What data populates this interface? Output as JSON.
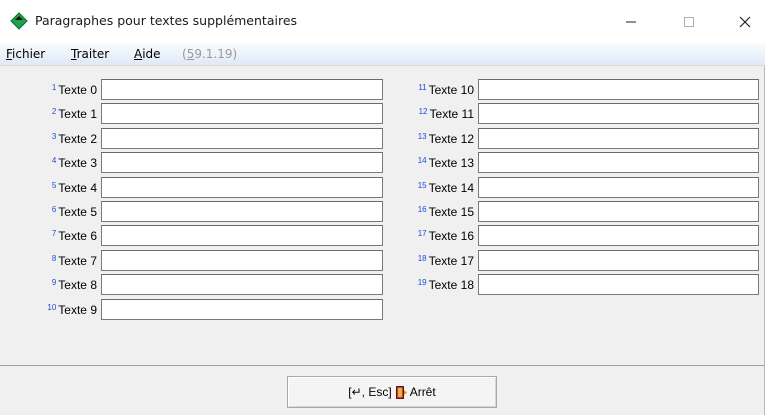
{
  "window": {
    "title": "Paragraphes pour textes supplémentaires",
    "icon": "green-diamond-app-icon",
    "controls": {
      "minimize": "–",
      "maximize": "□",
      "close": "✕"
    }
  },
  "menu": {
    "items": [
      {
        "first": "F",
        "rest": "ichier"
      },
      {
        "first": "T",
        "rest": "raiter"
      },
      {
        "first": "A",
        "rest": "ide"
      }
    ],
    "version_first": "5",
    "version_rest": "9.1.19",
    "version_prefix": "(",
    "version_suffix": ")"
  },
  "fields_left": [
    {
      "num": "1",
      "label": "Texte 0",
      "value": ""
    },
    {
      "num": "2",
      "label": "Texte 1",
      "value": ""
    },
    {
      "num": "3",
      "label": "Texte 2",
      "value": ""
    },
    {
      "num": "4",
      "label": "Texte 3",
      "value": ""
    },
    {
      "num": "5",
      "label": "Texte 4",
      "value": ""
    },
    {
      "num": "6",
      "label": "Texte 5",
      "value": ""
    },
    {
      "num": "7",
      "label": "Texte 6",
      "value": ""
    },
    {
      "num": "8",
      "label": "Texte 7",
      "value": ""
    },
    {
      "num": "9",
      "label": "Texte 8",
      "value": ""
    },
    {
      "num": "10",
      "label": "Texte 9",
      "value": ""
    }
  ],
  "fields_right": [
    {
      "num": "11",
      "label": "Texte 10",
      "value": ""
    },
    {
      "num": "12",
      "label": "Texte 11",
      "value": ""
    },
    {
      "num": "13",
      "label": "Texte 12",
      "value": ""
    },
    {
      "num": "14",
      "label": "Texte 13",
      "value": ""
    },
    {
      "num": "15",
      "label": "Texte 14",
      "value": ""
    },
    {
      "num": "16",
      "label": "Texte 15",
      "value": ""
    },
    {
      "num": "17",
      "label": "Texte 16",
      "value": ""
    },
    {
      "num": "18",
      "label": "Texte 17",
      "value": ""
    },
    {
      "num": "19",
      "label": "Texte 18",
      "value": ""
    }
  ],
  "footer": {
    "stop_prefix": "[↵, Esc]",
    "stop_label": "Arrêt",
    "stop_icon": "exit-door-icon"
  },
  "colors": {
    "field_number": "#1a4fd8",
    "app_icon": "#1fa34a",
    "version_text": "#9a9a9a"
  }
}
